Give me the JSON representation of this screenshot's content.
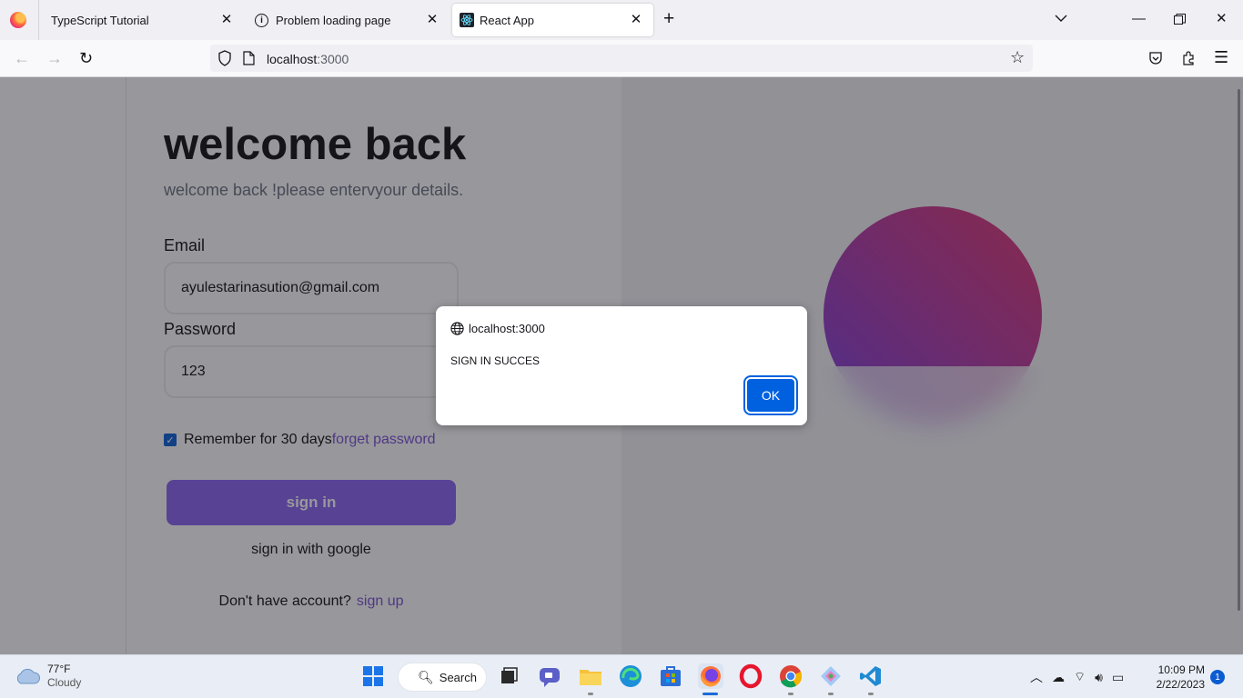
{
  "browser": {
    "tabs": [
      {
        "title": "TypeScript Tutorial",
        "icon": "firefox-icon"
      },
      {
        "title": "Problem loading page",
        "icon": "info-icon"
      },
      {
        "title": "React App",
        "icon": "react-icon",
        "active": true
      }
    ],
    "url_host": "localhost",
    "url_port": ":3000"
  },
  "page": {
    "heading": "welcome back",
    "subheading": "welcome back !please entervyour details.",
    "email_label": "Email",
    "email_value": "ayulestarinasution@gmail.com",
    "password_label": "Password",
    "password_value": "123",
    "remember_checked": true,
    "remember_label": "Remember for 30 days",
    "forget_link": "forget password",
    "signin_button": "sign in",
    "google_button": "sign in with google",
    "no_account_text": "Don't have account?",
    "signup_link": "sign up",
    "accent_color": "#8a63f0"
  },
  "dialog": {
    "origin": "localhost:3000",
    "message": "SIGN IN SUCCES",
    "ok_label": "OK"
  },
  "taskbar": {
    "weather_temp": "77°F",
    "weather_condition": "Cloudy",
    "search_label": "Search",
    "time": "10:09 PM",
    "date": "2/22/2023",
    "notification_count": "1"
  }
}
